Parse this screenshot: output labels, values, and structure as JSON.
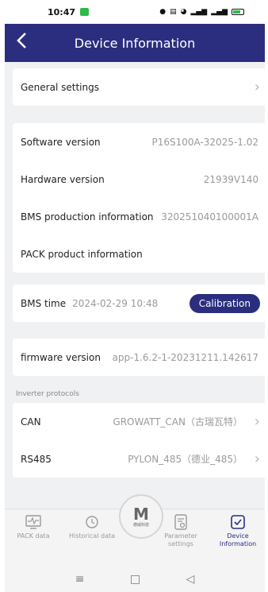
{
  "status_bar": {
    "time": "10:47",
    "icons": [
      "chat-icon",
      "mute-icon",
      "hd-icon",
      "wifi-icon",
      "signal-icon",
      "signal-icon",
      "battery-icon"
    ]
  },
  "header": {
    "title": "Device Information"
  },
  "general": {
    "label": "General settings"
  },
  "versions": [
    {
      "label": "Software version",
      "value": "P16S100A-32025-1.02"
    },
    {
      "label": "Hardware version",
      "value": "21939V140"
    },
    {
      "label": "BMS production information",
      "value": "320251040100001A"
    },
    {
      "label": "PACK product information",
      "value": ""
    }
  ],
  "bms_time": {
    "label": "BMS time",
    "value": "2024-02-29 10:48",
    "button": "Calibration"
  },
  "firmware": {
    "label": "firmware version",
    "value": "app-1.6.2-1-20231211.142617"
  },
  "inverter": {
    "section_label": "Inverter protocols",
    "rows": [
      {
        "label": "CAN",
        "value": "GROWATT_CAN（古瑞瓦特）"
      },
      {
        "label": "RS485",
        "value": "PYLON_485（德业_485）"
      }
    ]
  },
  "tabbar": {
    "tabs": [
      {
        "label": "PACK data",
        "icon": "pack-data-icon"
      },
      {
        "label": "Historical data",
        "icon": "history-icon"
      },
      {
        "label": "Parameter settings",
        "icon": "parameter-icon"
      },
      {
        "label": "Device Information",
        "icon": "device-info-icon"
      }
    ],
    "logo": "M",
    "logo_caption": "德威科技"
  },
  "colors": {
    "primary": "#2b2e7e",
    "background": "#f0f1f3",
    "muted": "#9a9a9a"
  }
}
